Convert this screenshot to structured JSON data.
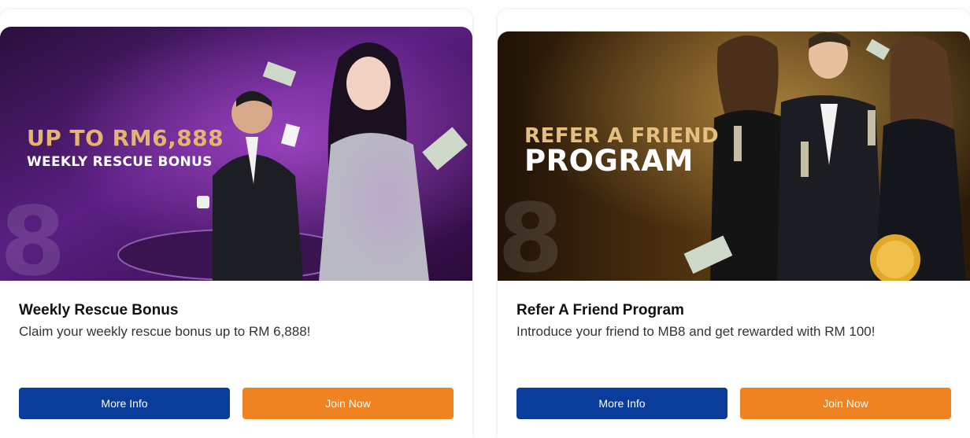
{
  "colors": {
    "more_info_bg": "#0a3d9b",
    "join_now_bg": "#ef8221"
  },
  "cards": [
    {
      "banner": {
        "line1": "UP TO RM6,888",
        "line2": "WEEKLY RESCUE BONUS"
      },
      "title": "Weekly Rescue Bonus",
      "description": "Claim your weekly rescue bonus up to RM 6,888!",
      "more_info": "More Info",
      "join_now": "Join Now"
    },
    {
      "banner": {
        "line1": "REFER A FRIEND",
        "line2": "PROGRAM"
      },
      "title": "Refer A Friend Program",
      "description": "Introduce your friend to MB8 and get rewarded with RM 100!",
      "more_info": "More Info",
      "join_now": "Join Now"
    }
  ]
}
